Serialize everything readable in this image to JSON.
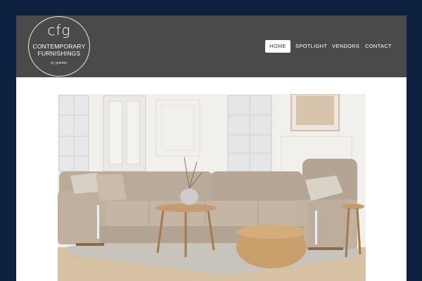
{
  "logo": {
    "mark": "cfg",
    "line1": "CONTEMPORARY",
    "line2": "FURNISHINGS",
    "sub": "by gramby"
  },
  "nav": {
    "items": [
      "HOME",
      "SPOTLIGHT",
      "VENDORS",
      "CONTACT"
    ],
    "active": "HOME"
  },
  "colors": {
    "page_background": "#0d2240",
    "header_background": "#4a4a4a",
    "nav_active_background": "#ffffff"
  },
  "hero": {
    "icon": "sectional-sofa-living-room-photo"
  }
}
